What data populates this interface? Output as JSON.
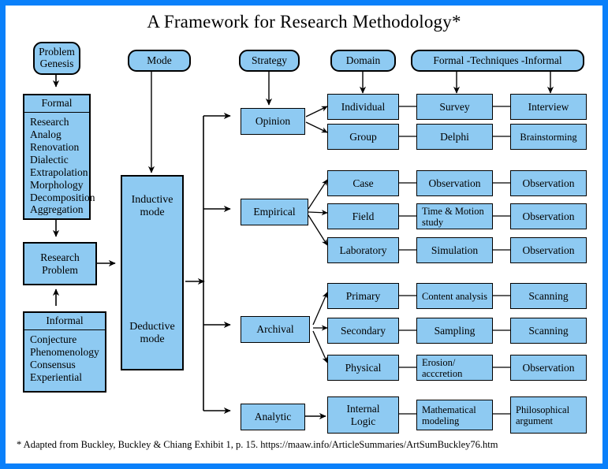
{
  "page": {
    "title": "A Framework for Research Methodology*",
    "footnote": "* Adapted from Buckley, Buckley & Chiang Exhibit 1, p. 15.  https://maaw.info/ArticleSummaries/ArtSumBuckley76.htm",
    "border_color": "#0a80fa",
    "box_fill": "#8ECAF2",
    "box_stroke": "#000000",
    "background": "#ffffff"
  },
  "headers": {
    "problem_genesis": "Problem\nGenesis",
    "problem_genesis_line1": "Problem",
    "problem_genesis_line2": "Genesis",
    "mode": "Mode",
    "strategy": "Strategy",
    "domain": "Domain",
    "techniques": "Formal -Techniques -Informal"
  },
  "genesis": {
    "formal": {
      "heading": "Formal",
      "items": [
        "Research",
        "Analog",
        "Renovation",
        "Dialectic",
        "Extrapolation",
        "Morphology",
        "Decomposition",
        "Aggregation"
      ]
    },
    "informal": {
      "heading": "Informal",
      "items": [
        "Conjecture",
        "Phenomenology",
        "Consensus",
        "Experiential"
      ]
    },
    "research_problem_line1": "Research",
    "research_problem_line2": "Problem"
  },
  "mode_box": {
    "inductive_line1": "Inductive",
    "inductive_line2": "mode",
    "deductive_line1": "Deductive",
    "deductive_line2": "mode"
  },
  "strategies": [
    {
      "label": "Opinion"
    },
    {
      "label": "Empirical"
    },
    {
      "label": "Archival"
    },
    {
      "label": "Analytic"
    }
  ],
  "rows": [
    {
      "domain": "Individual",
      "formal": "Survey",
      "informal": "Interview"
    },
    {
      "domain": "Group",
      "formal": "Delphi",
      "informal": "Brainstorming"
    },
    {
      "domain": "Case",
      "formal": "Observation",
      "informal": "Observation"
    },
    {
      "domain": "Field",
      "formal_line1": "Time & Motion",
      "formal_line2": "study",
      "formal": "Time & Motion study",
      "informal": "Observation"
    },
    {
      "domain": "Laboratory",
      "formal": "Simulation",
      "informal": "Observation"
    },
    {
      "domain": "Primary",
      "formal": "Content analysis",
      "informal": "Scanning"
    },
    {
      "domain": "Secondary",
      "formal": "Sampling",
      "informal": "Scanning"
    },
    {
      "domain": "Physical",
      "formal_line1": "Erosion/",
      "formal_line2": "acccretion",
      "formal": "Erosion/ acccretion",
      "informal": "Observation"
    },
    {
      "domain_line1": "Internal",
      "domain_line2": "Logic",
      "domain": "Internal Logic",
      "formal_line1": "Mathematical",
      "formal_line2": "modeling",
      "formal": "Mathematical modeling",
      "informal_line1": "Philosophical",
      "informal_line2": "argument",
      "informal": "Philosophical argument"
    }
  ]
}
